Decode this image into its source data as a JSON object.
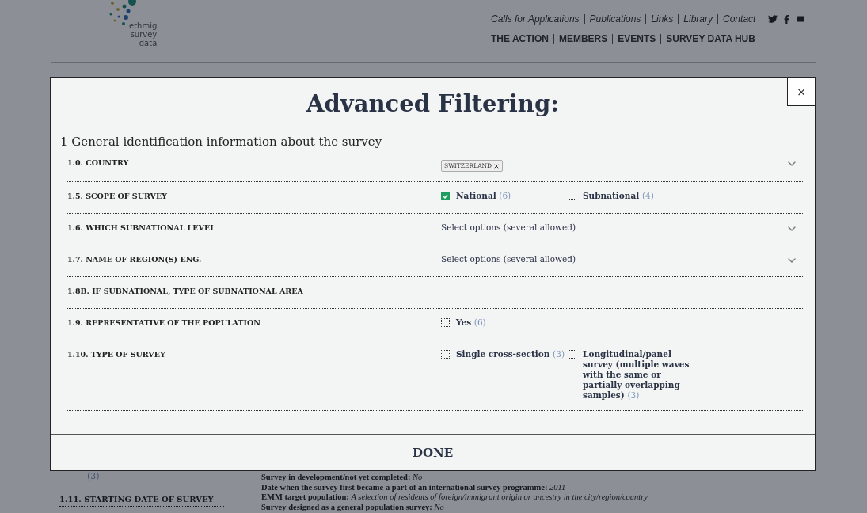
{
  "header": {
    "logo_lines": [
      "ethmig",
      "survey",
      "data"
    ],
    "top_links": [
      "Calls for Applications",
      "Publications",
      "Links",
      "Library",
      "Contact"
    ],
    "nav": [
      "THE ACTION",
      "MEMBERS",
      "EVENTS",
      "SURVEY DATA HUB"
    ]
  },
  "background": {
    "left_count": "(3)",
    "left_heading": "1.11. STARTING DATE OF SURVEY",
    "details": [
      "**Survey in development/not yet completed:** *No*",
      "**Date when the survey first became a part of an international survey programme:** *2011*",
      "**EMM target population:** *A selection of residents of foreign/immigrant origin or ancestry in the city/region/country*",
      "**Survey designed as a general population survey:** *No*"
    ]
  },
  "modal": {
    "title": "Advanced Filtering:",
    "close": "×",
    "section": "1 General identification information about the survey",
    "filters": [
      {
        "label": "1.0. COUNTRY",
        "kind": "tags",
        "tags": [
          "SWITZERLAND"
        ]
      },
      {
        "label": "1.5. SCOPE OF SURVEY",
        "kind": "checkboxes",
        "options": [
          {
            "label": "National",
            "count": "(6)",
            "checked": true
          },
          {
            "label": "Subnational",
            "count": "(4)",
            "checked": false
          }
        ]
      },
      {
        "label": "1.6. WHICH SUBNATIONAL LEVEL",
        "kind": "select",
        "placeholder": "Select options (several allowed)"
      },
      {
        "label": "1.7. NAME OF REGION(S) ENG.",
        "kind": "select",
        "placeholder": "Select options (several allowed)"
      },
      {
        "label": "1.8B. IF SUBNATIONAL, TYPE OF SUBNATIONAL AREA",
        "kind": "blank"
      },
      {
        "label": "1.9. REPRESENTATIVE OF THE POPULATION",
        "kind": "checkboxes",
        "options": [
          {
            "label": "Yes",
            "count": "(6)",
            "checked": false
          }
        ]
      },
      {
        "label": "1.10. TYPE OF SURVEY",
        "kind": "checkboxes",
        "options": [
          {
            "label": "Single cross-section",
            "count": "(3)",
            "checked": false
          },
          {
            "label": "Longitudinal/panel survey (multiple waves with the same or partially overlapping samples)",
            "count": "(3)",
            "checked": false
          }
        ]
      }
    ],
    "done": "DONE"
  }
}
